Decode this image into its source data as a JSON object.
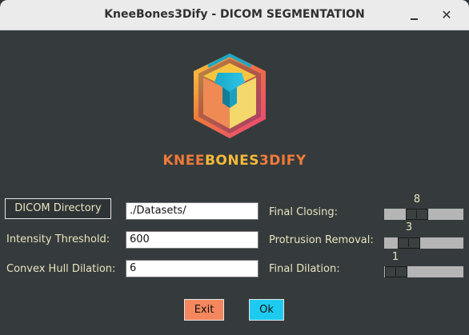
{
  "window": {
    "title": "KneeBones3Dify - DICOM SEGMENTATION",
    "minimize_icon": "minimize-icon",
    "close_icon": "close-icon",
    "close_glyph": "✕"
  },
  "logo": {
    "icon": "kneebones3dify-logo",
    "brand_part1": "KNEE",
    "brand_part2": "BONES",
    "brand_part3": "3DIFY",
    "colors": {
      "orange": "#f07a3a",
      "yellow": "#f5b93a",
      "teal": "#1aa8c7",
      "pink": "#e9437a"
    }
  },
  "form": {
    "dicom_button_label": "DICOM Directory",
    "dicom_directory_value": "./Datasets/",
    "intensity_label": "Intensity Threshold:",
    "intensity_value": "600",
    "convex_label": "Convex Hull Dilation:",
    "convex_value": "6",
    "final_closing_label": "Final Closing:",
    "final_closing_value": "8",
    "protrusion_label": "Protrusion Removal:",
    "protrusion_value": "3",
    "final_dilation_label": "Final Dilation:",
    "final_dilation_value": "1"
  },
  "buttons": {
    "exit_label": "Exit",
    "ok_label": "Ok",
    "exit_color": "#f4875e",
    "ok_color": "#1ecbf0"
  }
}
